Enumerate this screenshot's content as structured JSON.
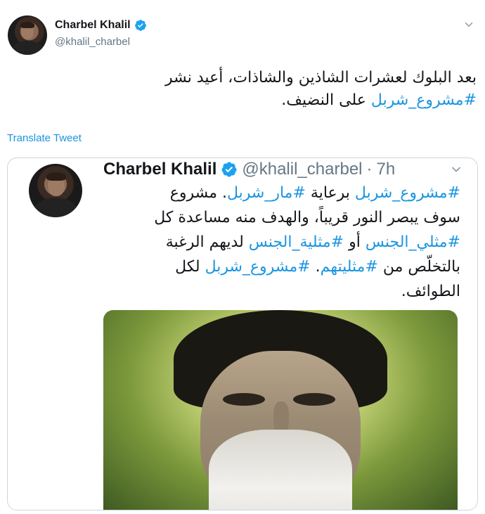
{
  "tweet": {
    "author_name": "Charbel Khalil",
    "author_handle": "@khalil_charbel",
    "text_line1": "بعد البلوك لعشرات الشاذين والشاذات، أعيد نشر",
    "text_hashtag": "#مشروع_شربل",
    "text_line2_rest": " على النضيف.",
    "translate_label": "Translate Tweet"
  },
  "quoted": {
    "author_name": "Charbel Khalil",
    "author_handle": "@khalil_charbel",
    "separator": "·",
    "time": "7h",
    "seg1": "#مشروع_شربل",
    "seg2": " برعاية ",
    "seg3": "#مار_شربل",
    "seg4": ". مشروع سوف يبصر النور قريباً، والهدف منه مساعدة كل ",
    "seg5": "#مثلي_الجنس",
    "seg6": " أو ",
    "seg7": "#مثلية_الجنس",
    "seg8": " لديهم الرغبة بالتخلّص من ",
    "seg9": "#مثليتهم",
    "seg10": ". ",
    "seg11": "#مشروع_شربل",
    "seg12": " لكل الطوائف."
  },
  "icons": {
    "verified": "verified-badge-icon",
    "chevron": "chevron-down-icon"
  },
  "colors": {
    "accent": "#1b95e0",
    "secondary_text": "#657786",
    "border": "#ccd6dd"
  }
}
